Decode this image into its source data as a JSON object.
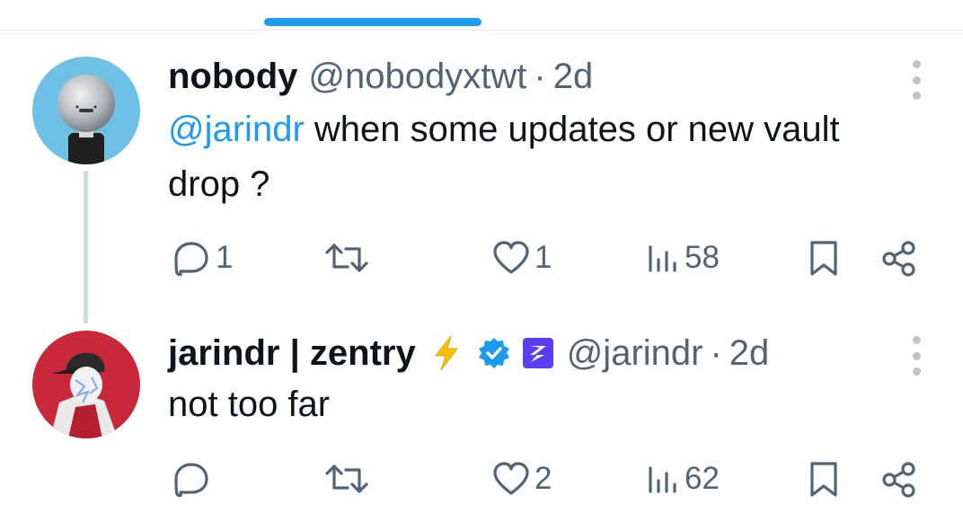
{
  "colors": {
    "accent": "#1d9bf0",
    "text_primary": "#0f1419",
    "text_secondary": "#536471",
    "thread_line": "#cfd9de",
    "bolt": "#f4c20d",
    "brand_badge": "#5b3df5"
  },
  "tweets": [
    {
      "display_name": "nobody",
      "handle": "@nobodyxtwt",
      "separator": "·",
      "time": "2d",
      "mention": "@jarindr",
      "text": " when some updates or new vault drop ?",
      "avatar_icon": "robot-avatar",
      "actions": {
        "reply_count": "1",
        "retweet_count": "",
        "like_count": "1",
        "views_count": "58"
      }
    },
    {
      "display_name": "jarindr | zentry",
      "name_emoji": "lightning-bolt-icon",
      "verified_icon": "verified-badge-icon",
      "brand_icon": "zentry-badge-icon",
      "handle": "@jarindr",
      "separator": "·",
      "time": "2d",
      "text": "not too far",
      "avatar_icon": "red-cap-avatar",
      "actions": {
        "reply_count": "",
        "retweet_count": "",
        "like_count": "2",
        "views_count": "62"
      }
    }
  ]
}
